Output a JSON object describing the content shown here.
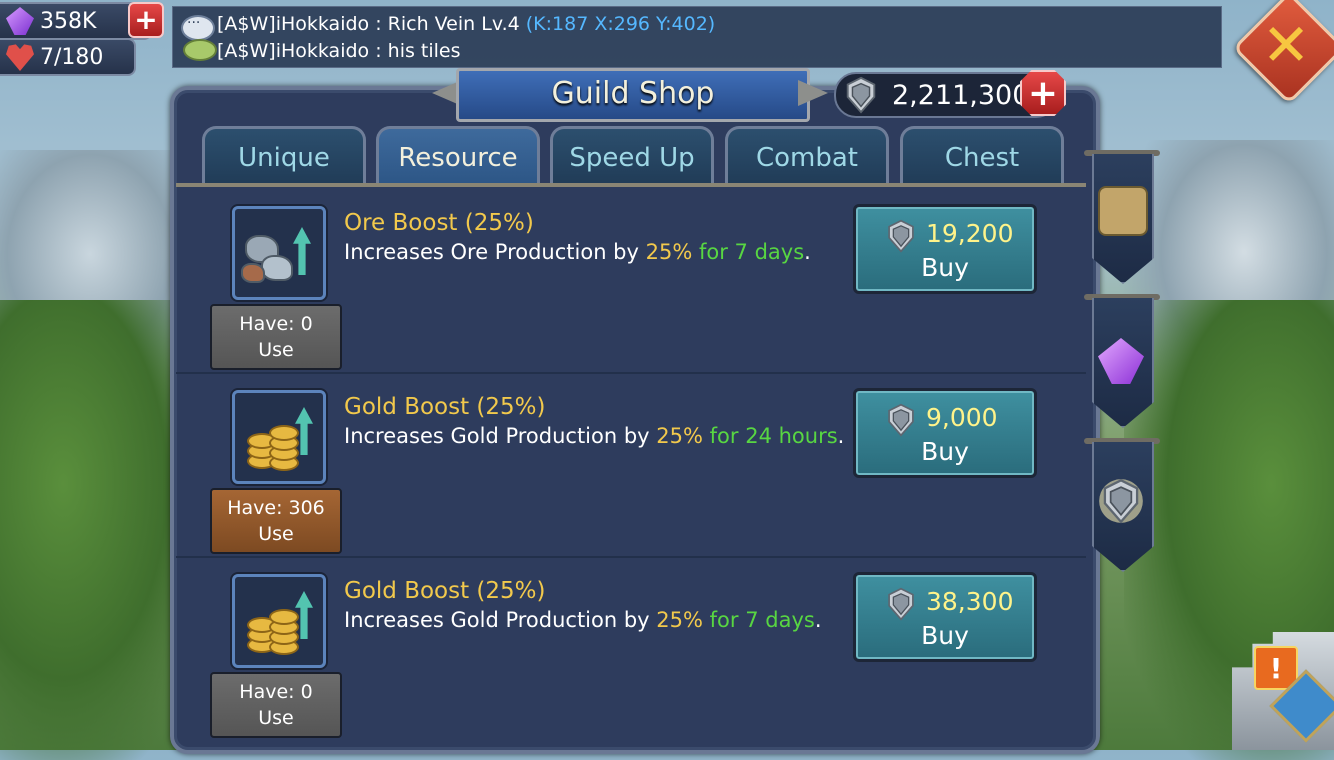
{
  "resources": {
    "gems": "358K",
    "stamina": "7/180"
  },
  "chat": {
    "line1_prefix": "[A$W]iHokkaido : Rich Vein Lv.4 ",
    "line1_coord": "(K:187 X:296 Y:402)",
    "line2": "[A$W]iHokkaido : his tiles"
  },
  "shop": {
    "title": "Guild Shop",
    "currency_value": "2,211,300",
    "tabs": [
      {
        "label": "Unique",
        "active": false
      },
      {
        "label": "Resource",
        "active": true
      },
      {
        "label": "Speed Up",
        "active": false
      },
      {
        "label": "Combat",
        "active": false
      },
      {
        "label": "Chest",
        "active": false
      }
    ],
    "items": [
      {
        "name": "Ore Boost (25%)",
        "desc_prefix": "Increases Ore Production by ",
        "desc_pct": "25%",
        "desc_dur": " for 7 days",
        "desc_suffix": ".",
        "price": "19,200",
        "buy_label": "Buy",
        "have": "Have: 0",
        "use_label": "Use",
        "icon": "ore-boost-icon"
      },
      {
        "name": "Gold Boost (25%)",
        "desc_prefix": "Increases Gold Production by ",
        "desc_pct": "25%",
        "desc_dur": " for 24 hours",
        "desc_suffix": ".",
        "price": "9,000",
        "buy_label": "Buy",
        "have": "Have: 306",
        "use_label": "Use",
        "icon": "gold-boost-icon"
      },
      {
        "name": "Gold Boost (25%)",
        "desc_prefix": "Increases Gold Production by ",
        "desc_pct": "25%",
        "desc_dur": " for 7 days",
        "desc_suffix": ".",
        "price": "38,300",
        "buy_label": "Buy",
        "have": "Have: 0",
        "use_label": "Use",
        "icon": "gold-boost-icon"
      }
    ]
  },
  "colors": {
    "accent_gold": "#f2c94c",
    "duration_green": "#58d642",
    "coord_blue": "#55b8ff",
    "buy_button": "#3f90a0"
  }
}
